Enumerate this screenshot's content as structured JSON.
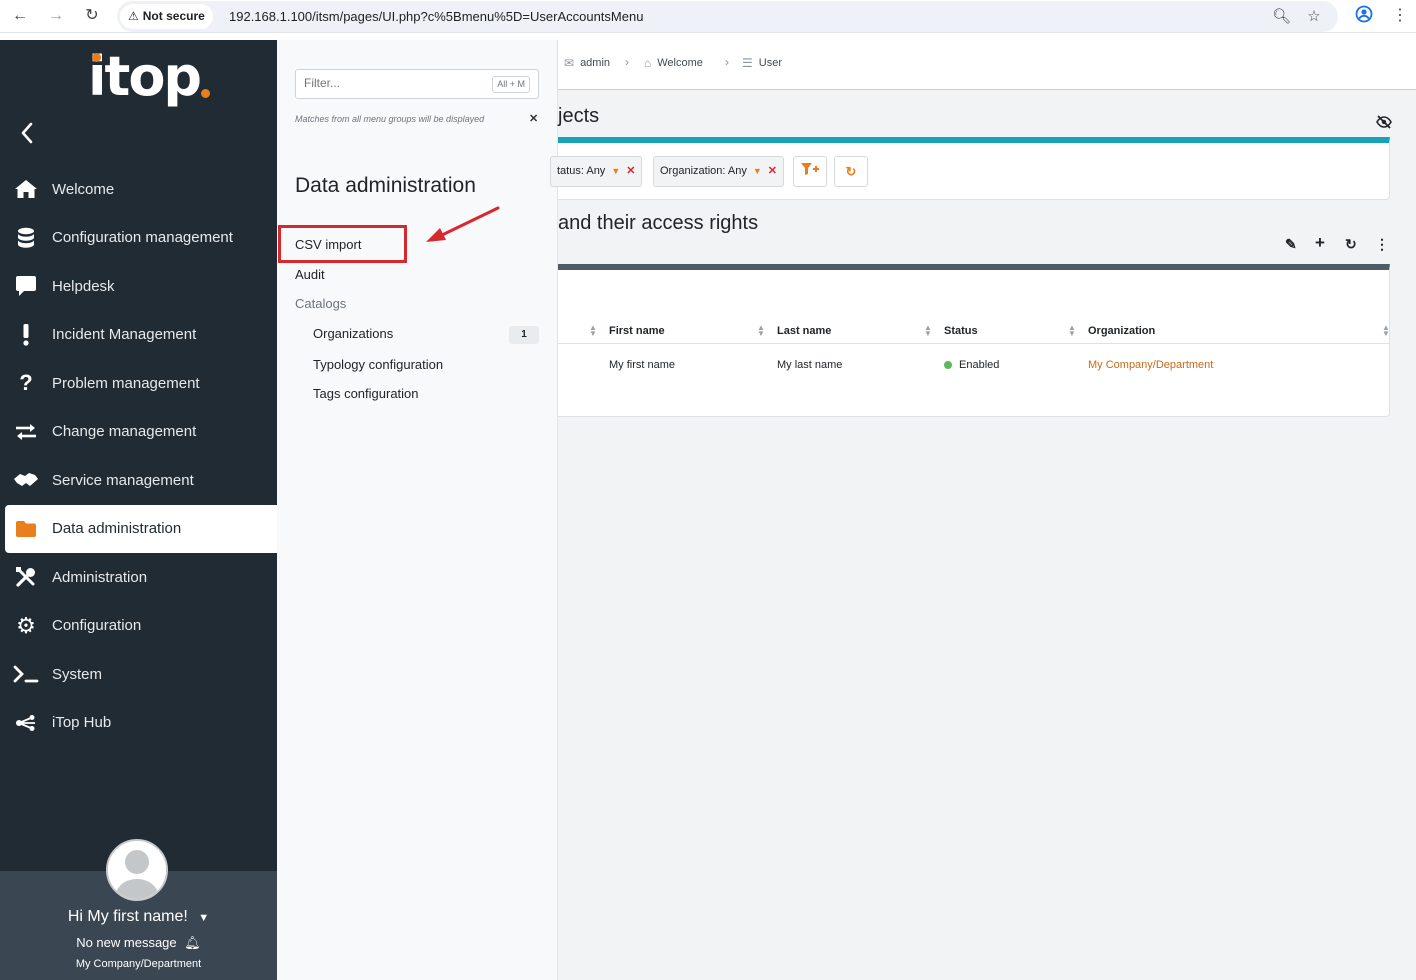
{
  "browser": {
    "security_label": "Not secure",
    "url": "192.168.1.100/itsm/pages/UI.php?c%5Bmenu%5D=UserAccountsMenu"
  },
  "logo": {
    "text": "itop"
  },
  "sidebar": {
    "items": [
      {
        "label": "Welcome",
        "icon": "home-icon"
      },
      {
        "label": "Configuration management",
        "icon": "database-icon"
      },
      {
        "label": "Helpdesk",
        "icon": "comment-icon"
      },
      {
        "label": "Incident Management",
        "icon": "exclamation-icon"
      },
      {
        "label": "Problem management",
        "icon": "question-icon"
      },
      {
        "label": "Change management",
        "icon": "exchange-icon"
      },
      {
        "label": "Service management",
        "icon": "handshake-icon"
      },
      {
        "label": "Data administration",
        "icon": "folder-icon",
        "active": true
      },
      {
        "label": "Administration",
        "icon": "tools-icon"
      },
      {
        "label": "Configuration",
        "icon": "gear-icon"
      },
      {
        "label": "System",
        "icon": "terminal-icon"
      },
      {
        "label": "iTop Hub",
        "icon": "share-icon"
      }
    ],
    "user": {
      "greeting": "Hi My first name!",
      "messages": "No new message",
      "organization": "My Company/Department"
    }
  },
  "drawer": {
    "filter_placeholder": "Filter...",
    "filter_shortcut": "All + M",
    "filter_hint": "Matches from all menu groups will be displayed",
    "title": "Data administration",
    "links": {
      "csv_import": "CSV import",
      "audit": "Audit",
      "catalogs": "Catalogs",
      "organizations": "Organizations",
      "organizations_count": "1",
      "typology": "Typology configuration",
      "tags": "Tags configuration"
    }
  },
  "breadcrumb": {
    "items": [
      "admin",
      "Welcome",
      "User"
    ]
  },
  "search": {
    "title_partial": "jects",
    "criteria": [
      {
        "label": "tatus: Any"
      },
      {
        "label": "Organization: Any"
      }
    ]
  },
  "list": {
    "title_partial": "and their access rights",
    "columns": [
      "First name",
      "Last name",
      "Status",
      "Organization"
    ],
    "rows": [
      {
        "first_name": "My first name",
        "last_name": "My last name",
        "status": "Enabled",
        "organization": "My Company/Department"
      }
    ]
  },
  "colors": {
    "sidebar_bg": "#212b33",
    "accent": "#ea7d1e",
    "search_bar": "#17a2b8",
    "highlight": "#d7282f",
    "status_enabled": "#5cb85c"
  }
}
